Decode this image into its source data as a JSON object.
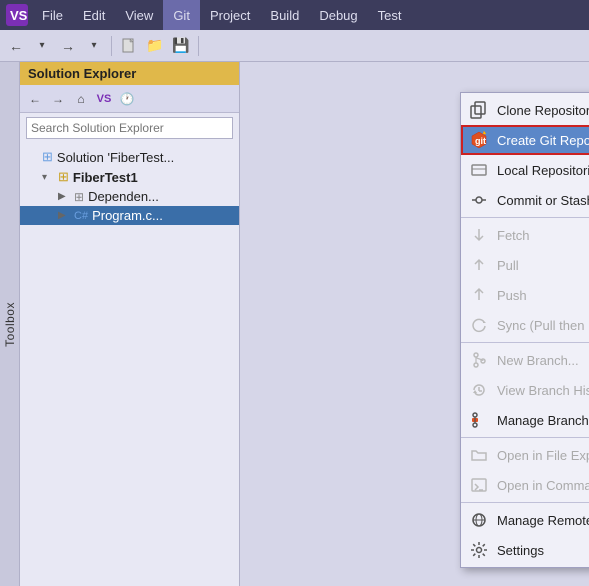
{
  "titlebar": {
    "logo": "VS",
    "menu_items": [
      "File",
      "Edit",
      "View",
      "Git",
      "Project",
      "Build",
      "Debug",
      "Test"
    ]
  },
  "menu_active": "Git",
  "toolbox": {
    "label": "Toolbox"
  },
  "solution_explorer": {
    "title": "Solution Explorer",
    "search_placeholder": "Search Solution Explorer",
    "tree": [
      {
        "label": "Solution 'FiberTest...",
        "indent": 0,
        "type": "solution",
        "expand": false
      },
      {
        "label": "FiberTest1",
        "indent": 1,
        "type": "cs-project",
        "expand": true,
        "bold": true
      },
      {
        "label": "Dependen...",
        "indent": 2,
        "type": "deps",
        "expand": false
      },
      {
        "label": "Program.c...",
        "indent": 2,
        "type": "cs-file",
        "expand": false,
        "selected": true
      }
    ]
  },
  "git_menu": {
    "items": [
      {
        "id": "clone",
        "label": "Clone Repository...",
        "icon": "clone",
        "disabled": false,
        "has_arrow": false
      },
      {
        "id": "create",
        "label": "Create Git Repository...",
        "icon": "git-create",
        "disabled": false,
        "has_arrow": false,
        "highlighted": true,
        "outlined": true
      },
      {
        "id": "local",
        "label": "Local Repositories...",
        "icon": "local-repo",
        "disabled": false,
        "has_arrow": true
      },
      {
        "id": "commit",
        "label": "Commit or Stash...",
        "icon": "commit",
        "disabled": false,
        "has_arrow": false
      },
      {
        "id": "sep1",
        "type": "sep"
      },
      {
        "id": "fetch",
        "label": "Fetch",
        "icon": "fetch",
        "disabled": true,
        "has_arrow": false
      },
      {
        "id": "pull",
        "label": "Pull",
        "icon": "pull",
        "disabled": true,
        "has_arrow": false
      },
      {
        "id": "push",
        "label": "Push",
        "icon": "push",
        "disabled": true,
        "has_arrow": false
      },
      {
        "id": "sync",
        "label": "Sync (Pull then Push)",
        "icon": "sync",
        "disabled": true,
        "has_arrow": false
      },
      {
        "id": "sep2",
        "type": "sep"
      },
      {
        "id": "new-branch",
        "label": "New Branch...",
        "icon": "branch",
        "disabled": true,
        "has_arrow": false
      },
      {
        "id": "view-history",
        "label": "View Branch History",
        "icon": "history",
        "disabled": true,
        "has_arrow": false
      },
      {
        "id": "manage-branches",
        "label": "Manage Branches",
        "icon": "manage-branch",
        "disabled": false,
        "has_arrow": false
      },
      {
        "id": "sep3",
        "type": "sep"
      },
      {
        "id": "file-explorer",
        "label": "Open in File Explorer",
        "icon": "folder",
        "disabled": true,
        "has_arrow": false
      },
      {
        "id": "cmd-prompt",
        "label": "Open in Command Prompt",
        "icon": "terminal",
        "disabled": true,
        "has_arrow": false
      },
      {
        "id": "sep4",
        "type": "sep"
      },
      {
        "id": "remotes",
        "label": "Manage Remotes...",
        "icon": "remotes",
        "disabled": false,
        "has_arrow": false
      },
      {
        "id": "settings",
        "label": "Settings",
        "icon": "settings",
        "disabled": false,
        "has_arrow": false
      }
    ]
  }
}
